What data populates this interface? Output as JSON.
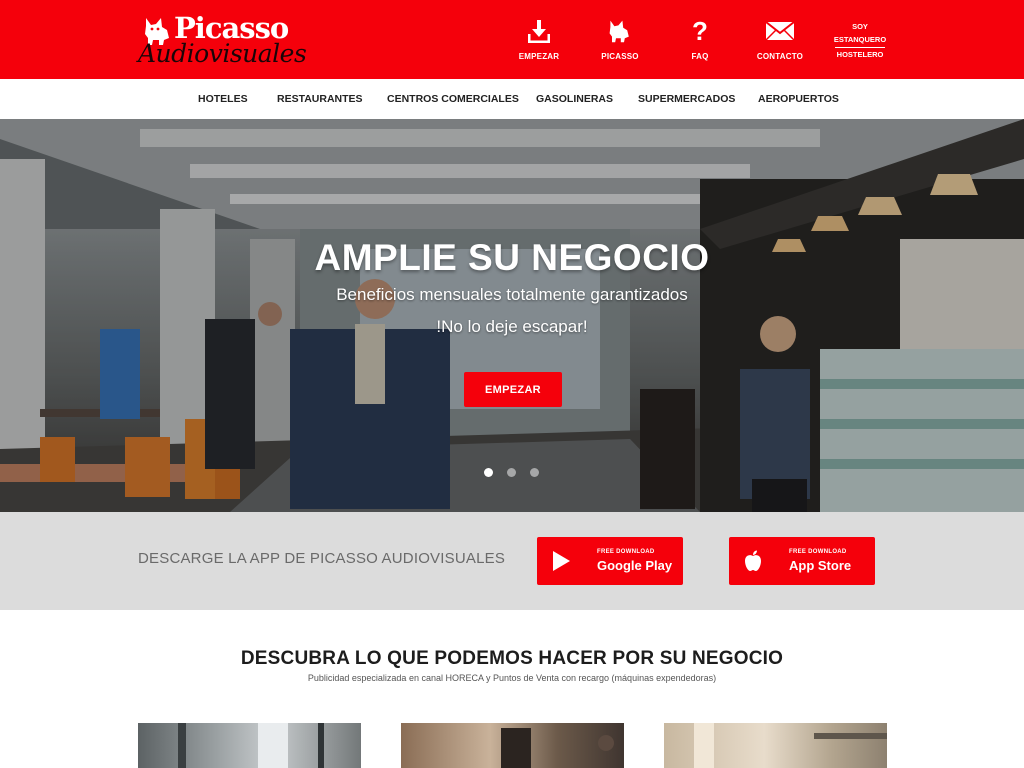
{
  "brand": {
    "name": "Picasso",
    "tagline": "Audiovisuales"
  },
  "topnav": [
    {
      "label": "EMPEZAR",
      "icon": "download-icon"
    },
    {
      "label": "PICASSO",
      "icon": "dog-icon"
    },
    {
      "label": "FAQ",
      "icon": "question-mark-icon"
    },
    {
      "label": "CONTACTO",
      "icon": "envelope-icon"
    }
  ],
  "soy": {
    "line1": "SOY",
    "line2": "ESTANQUERO",
    "line3": "HOSTELERO"
  },
  "categories": [
    "HOTELES",
    "RESTAURANTES",
    "CENTROS COMERCIALES",
    "GASOLINERAS",
    "SUPERMERCADOS",
    "AEROPUERTOS"
  ],
  "hero": {
    "title": "AMPLIE SU NEGOCIO",
    "subtitle": "Beneficios mensuales totalmente garantizados",
    "subtitle2": "!No lo deje escapar!",
    "cta": "EMPEZAR",
    "slides": 3,
    "active_slide": 1
  },
  "app": {
    "text": "DESCARGE LA APP DE PICASSO AUDIOVISUALES",
    "google": {
      "small": "FREE DOWNLOAD",
      "big": "Google Play",
      "icon": "play-icon"
    },
    "apple": {
      "small": "FREE DOWNLOAD",
      "big": "App Store",
      "icon": "apple-icon"
    }
  },
  "discover": {
    "title": "DESCUBRA LO QUE PODEMOS HACER POR SU NEGOCIO",
    "subtitle": "Publicidad especializada en canal HORECA y Puntos de Venta con recargo (máquinas expendedoras)"
  },
  "colors": {
    "brand_red": "#f5000b",
    "band_gray": "#dcdcdc",
    "text_dark": "#1d1d1d"
  }
}
